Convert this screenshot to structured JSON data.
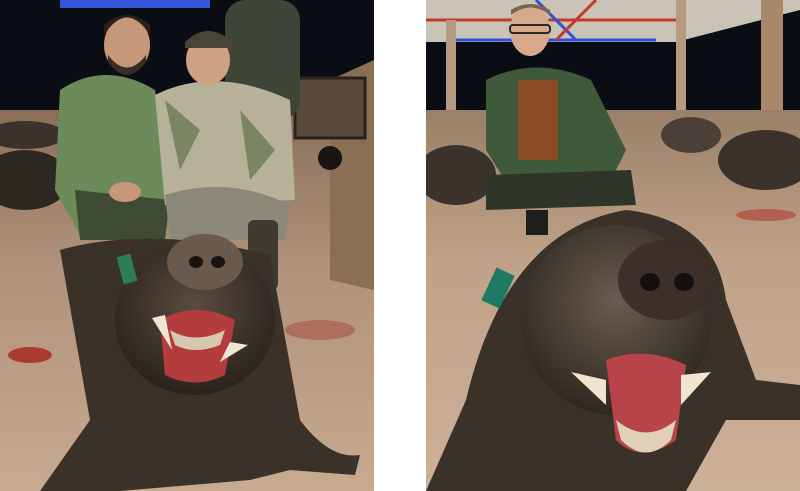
{
  "photos": [
    {
      "id": "left",
      "subjects": [
        "hunter-bearded",
        "hunter-cap",
        "standing-person",
        "wild-boar"
      ],
      "tag_color": "#2e7d5a"
    },
    {
      "id": "right",
      "subjects": [
        "hunter-glasses",
        "wild-boar"
      ],
      "tag_color": "#1f7a63"
    }
  ],
  "colors": {
    "night_sky": "#0b0d14",
    "floor": "#b89a7e",
    "boar_fur": "#3a3128",
    "jacket_green": "#3f5a3a",
    "roof_blue": "#2e4fd6",
    "roof_red": "#c23a2a"
  }
}
